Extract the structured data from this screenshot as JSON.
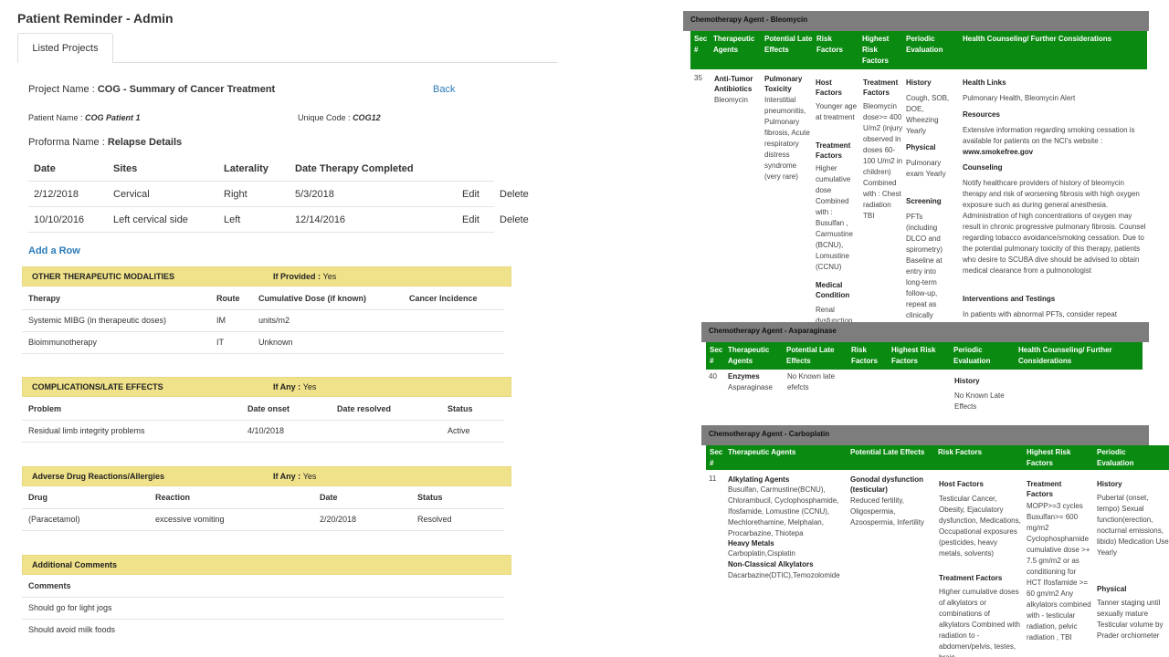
{
  "app_title": "Patient Reminder - Admin",
  "tab": "Listed Projects",
  "project": {
    "name_label": "Project Name :",
    "name_value": "COG - Summary of Cancer Treatment",
    "back": "Back",
    "patient_label": "Patient Name :",
    "patient_value": "COG Patient 1",
    "code_label": "Unique Code :",
    "code_value": "COG12",
    "proforma_label": "Proforma Name :",
    "proforma_value": "Relapse Details"
  },
  "relapse_table": {
    "headers": [
      "Date",
      "Sites",
      "Laterality",
      "Date Therapy Completed"
    ],
    "rows": [
      {
        "date": "2/12/2018",
        "sites": "Cervical",
        "laterality": "Right",
        "completed": "5/3/2018",
        "edit": "Edit",
        "delete": "Delete"
      },
      {
        "date": "10/10/2016",
        "sites": "Left cervical side",
        "laterality": "Left",
        "completed": "12/14/2016",
        "edit": "Edit",
        "delete": "Delete"
      }
    ],
    "add_row": "Add a Row"
  },
  "modalities": {
    "title": "OTHER THERAPEUTIC MODALITIES",
    "flag_label": "If Provided :",
    "flag_value": "Yes",
    "headers": [
      "Therapy",
      "Route",
      "Cumulative Dose (if known)",
      "Cancer Incidence"
    ],
    "rows": [
      {
        "therapy": "Systemic MIBG (in therapeutic doses)",
        "route": "IM",
        "dose": "units/m2"
      },
      {
        "therapy": "Bioimmunotherapy",
        "route": "IT",
        "dose": "Unknown"
      }
    ]
  },
  "complications": {
    "title": "COMPLICATIONS/LATE EFFECTS",
    "flag_label": "If Any :",
    "flag_value": "Yes",
    "headers": [
      "Problem",
      "Date onset",
      "Date resolved",
      "Status"
    ],
    "rows": [
      {
        "problem": "Residual limb integrity problems",
        "onset": "4/10/2018",
        "status": "Active"
      }
    ]
  },
  "adverse": {
    "title": "Adverse Drug Reactions/Allergies",
    "flag_label": "If Any :",
    "flag_value": "Yes",
    "headers": [
      "Drug",
      "Reaction",
      "Date",
      "Status"
    ],
    "rows": [
      {
        "drug": "(Paracetamol)",
        "reaction": "excessive vomiting",
        "date": "2/20/2018",
        "status": "Resolved"
      }
    ]
  },
  "comments": {
    "title": "Additional Comments",
    "header": "Comments",
    "rows": [
      "Should go for light jogs",
      "Should avoid milk foods"
    ]
  },
  "bleomycin": {
    "title": "Chemotherapy Agent - Bleomycin",
    "headers": [
      "Sec #",
      "Therapeutic Agents",
      "Potential Late Effects",
      "Risk Factors",
      "Highest Risk Factors",
      "Periodic Evaluation",
      "Health Counseling/ Further Considerations"
    ],
    "sec": "35",
    "agent_class": "Anti-Tumor Antibiotics",
    "agent": "Bleomycin",
    "late_effect_title": "Pulmonary Toxicity",
    "late_effects": "Interstitial pneumonitis, Pulmonary fibrosis, Acute respiratory distress syndrome (very rare)",
    "risk_host_title": "Host Factors",
    "risk_host": "Younger age at treatment",
    "risk_tx_title": "Treatment Factors",
    "risk_tx": "Higher cumulative dose Combined with : Busulfan , Carmustine (BCNU), Lomustine (CCNU)",
    "risk_med_title": "Medical Condition",
    "risk_med": "Renal dysfunction",
    "highest_title": "Treatment Factors",
    "highest": "Bleomycin dose>= 400 U/m2 (injury observed in doses 60-100 U/m2 in children) Combined with : Chest radiation TBI",
    "eval_history_title": "History",
    "eval_history": "Cough, SOB, DOE, Wheezing Yearly",
    "eval_physical_title": "Physical",
    "eval_physical": "Pulmonary exam Yearly",
    "eval_screen_title": "Screening",
    "eval_screen": "PFTs (including DLCO and spirometry) Baseline at entry into long-term follow-up, repeat as clinically",
    "hc_links_title": "Health Links",
    "hc_links": "Pulmonary Health, Bleomycin Alert",
    "hc_res_title": "Resources",
    "hc_res": "Extensive information regarding smoking cessation is available for patients on the NCI's website :",
    "hc_res_link": "www.smokefree.gov",
    "hc_couns_title": "Counseling",
    "hc_couns": "Notify healthcare providers of history of bleomycin therapy and risk of worsening fibrosis with high oxygen exposure such as during general anesthesia. Administration of high concentrations of oxygen may result in chronic progressive pulmonary fibrosis. Counsel regarding tobacco avoidance/smoking cessation. Due to the potential pulmonary toxicity of this therapy, patients who desire to SCUBA dive should be advised to obtain medical clearance from a pulmonologist",
    "hc_int_title": "Interventions and Testings",
    "hc_int": "In patients with abnormal PFTs, consider repeat"
  },
  "asparaginase": {
    "title": "Chemotherapy Agent - Asparaginase",
    "headers": [
      "Sec #",
      "Therapeutic Agents",
      "Potential Late Effects",
      "Risk Factors",
      "Highest Risk Factors",
      "Periodic Evaluation",
      "Health Counseling/ Further Considerations"
    ],
    "sec": "40",
    "agent_class": "Enzymes",
    "agent": "Asparaginase",
    "late_effects": "No Known late efefcts",
    "eval_title": "History",
    "eval": "No Known Late Effects"
  },
  "carboplatin": {
    "title": "Chemotherapy Agent - Carboplatin",
    "headers": [
      "Sec #",
      "Therapeutic Agents",
      "Potential Late Effects",
      "Risk Factors",
      "Highest Risk Factors",
      "Periodic Evaluation"
    ],
    "sec": "11",
    "alk_title": "Alkylating Agents",
    "alk": "Busulfan, Carmustine(BCNU), Chlorambucil, Cyclophosphamide, Ifosfamide, Lomustine (CCNU), Mechlorethamine, Melphalan, Procarbazine, Thiotepa",
    "heavy_title": "Heavy Metals",
    "heavy": "Carboplatin,Cisplatin",
    "nonclass_title": "Non-Classical Alkylators",
    "nonclass": "Dacarbazine(DTIC),Temozolomide",
    "late_title": "Gonodal dysfunction (testicular)",
    "late": "Reduced fertility, Oligospermia, Azoospermia, Infertility",
    "host_title": "Host Factors",
    "host": "Testicular Cancer, Obesity, Ejaculatory dysfunction, Medications, Occupational exposures (pesticides, heavy metals, solvents)",
    "tx_title": "Treatment Factors",
    "tx": "Higher cumulative doses of alkylators or combinations of alkylators Combined with radiation to - abdomen/pelvis, testes, brain",
    "highest_title": "Treatment Factors",
    "highest": "MOPP>=3 cycles Busulfan>= 600 mg/m2 Cyclophosphamide cumulative dose >+ 7.5 gm/m2 or as conditioning for HCT Ifosfamide >= 60 gm/m2 Any alkylators combined with - testicular radiation, pelvic radiation , TBI",
    "hist_title": "History",
    "hist": "Pubertal (onset, tempo) Sexual function(erection, nocturnal emissions, libido) Medication Use Yearly",
    "phys_title": "Physical",
    "phys": "Tanner staging until sexually mature Testicular volume by Prader orchiometer"
  },
  "colors": {
    "green": "#0b8a12",
    "grey": "#7d7d7d",
    "yellow": "#f0e28a",
    "link": "#2a7ab8"
  }
}
